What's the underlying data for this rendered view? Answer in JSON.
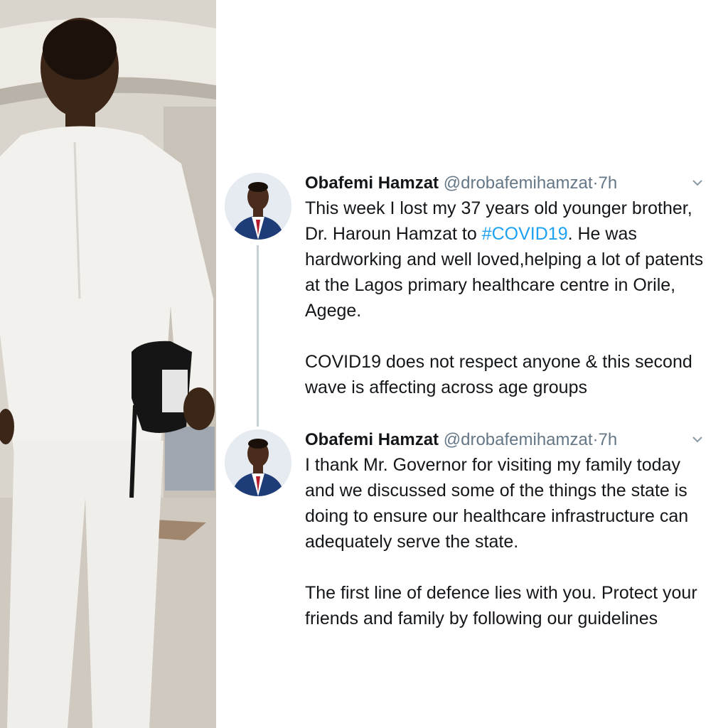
{
  "tweets": [
    {
      "author_name": "Obafemi Hamzat",
      "author_handle": "@drobafemihamzat",
      "separator": "·",
      "time": "7h",
      "body_part1": "This week I lost my 37 years old younger brother, Dr. Haroun Hamzat to ",
      "hashtag": "#COVID19",
      "body_part2": ". He was hardworking and well loved,helping a lot of patents at the Lagos primary healthcare centre in Orile, Agege.",
      "paragraph2": "COVID19 does not respect anyone & this second wave is affecting across age groups"
    },
    {
      "author_name": "Obafemi Hamzat",
      "author_handle": "@drobafemihamzat",
      "separator": "·",
      "time": "7h",
      "paragraph1": "I thank Mr. Governor for visiting my family today and we discussed some of the things the state is doing to ensure our healthcare infrastructure can adequately serve the state.",
      "paragraph2": "The first line of defence lies with you. Protect your friends and family by following our guidelines"
    }
  ],
  "icons": {
    "avatar": "profile-photo",
    "menu": "chevron-down-icon"
  },
  "colors": {
    "text": "#14171a",
    "muted": "#657786",
    "hashtag": "#1da1f2",
    "thread_line": "#c4cfd6"
  }
}
